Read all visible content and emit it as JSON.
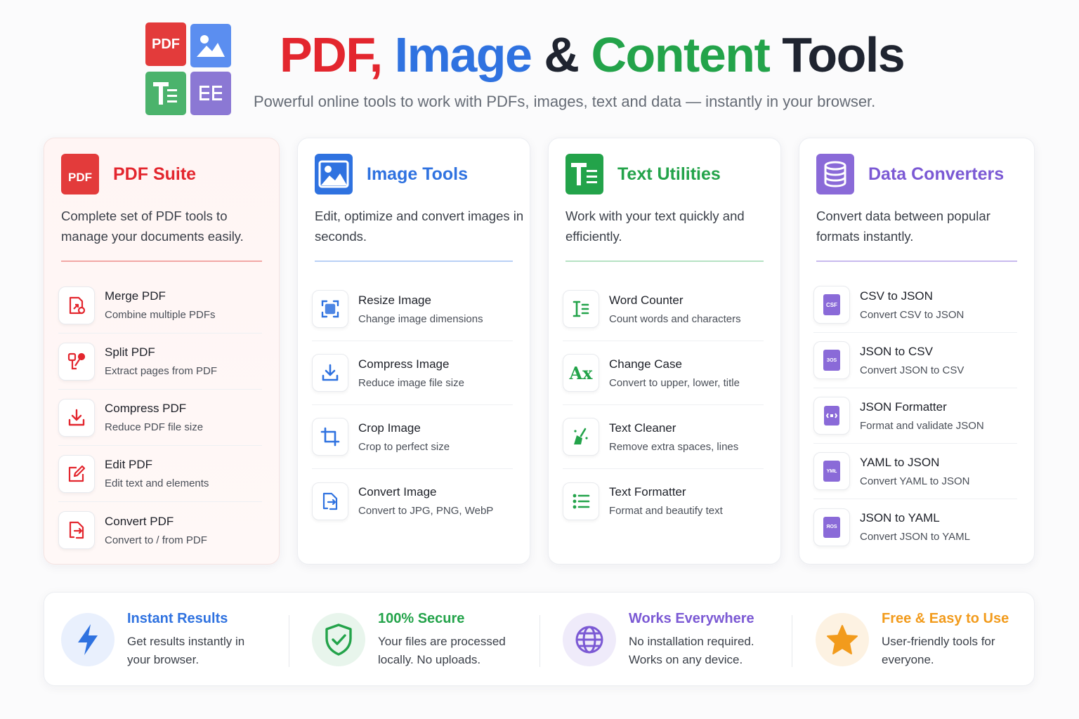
{
  "header": {
    "logo": {
      "pdf_tile_label": "PDF",
      "tiles": [
        "pdf-icon",
        "image-icon",
        "text-icon",
        "data-icon"
      ]
    },
    "title": {
      "part_pdf": "PDF,",
      "part_image": "Image",
      "part_amp": "&",
      "part_content": "Content",
      "part_tools": "Tools"
    },
    "subtitle": "Powerful online tools to work with PDFs, images, text and data — instantly in your browser."
  },
  "colors": {
    "pdf": "#e3262e",
    "image": "#2f72e0",
    "text": "#23a34a",
    "data": "#7b59d4",
    "orange": "#f29b1c"
  },
  "cards": {
    "pdf": {
      "icon": "pdf-file-icon",
      "icon_label": "PDF",
      "title": "PDF Suite",
      "description": "Complete set of PDF tools to manage your documents easily.",
      "tools": [
        {
          "name": "Merge PDF",
          "sub": "Combine multiple PDFs",
          "icon": "merge-icon"
        },
        {
          "name": "Split PDF",
          "sub": "Extract pages from PDF",
          "icon": "split-icon"
        },
        {
          "name": "Compress PDF",
          "sub": "Reduce PDF file size",
          "icon": "compress-icon"
        },
        {
          "name": "Edit PDF",
          "sub": "Edit text and elements",
          "icon": "edit-icon"
        },
        {
          "name": "Convert PDF",
          "sub": "Convert to / from PDF",
          "icon": "convert-icon"
        }
      ]
    },
    "image": {
      "icon": "image-icon",
      "title": "Image Tools",
      "description": "Edit, optimize and convert images in seconds.",
      "tools": [
        {
          "name": "Resize Image",
          "sub": "Change image dimensions",
          "icon": "resize-icon"
        },
        {
          "name": "Compress Image",
          "sub": "Reduce image file size",
          "icon": "download-icon"
        },
        {
          "name": "Crop Image",
          "sub": "Crop to perfect size",
          "icon": "crop-icon"
        },
        {
          "name": "Convert Image",
          "sub": "Convert to JPG, PNG, WebP",
          "icon": "convert-icon"
        }
      ]
    },
    "text": {
      "icon": "text-icon",
      "title": "Text Utilities",
      "description": "Work with your text quickly and efficiently.",
      "tools": [
        {
          "name": "Word Counter",
          "sub": "Count words and characters",
          "icon": "word-count-icon"
        },
        {
          "name": "Change Case",
          "sub": "Convert to upper, lower, title",
          "icon": "change-case-icon",
          "glyph": "Aх"
        },
        {
          "name": "Text Cleaner",
          "sub": "Remove extra spaces, lines",
          "icon": "broom-icon"
        },
        {
          "name": "Text Formatter",
          "sub": "Format and beautify text",
          "icon": "list-format-icon"
        }
      ]
    },
    "data": {
      "icon": "database-icon",
      "title": "Data Converters",
      "description": "Convert data between popular formats instantly.",
      "tools": [
        {
          "name": "CSV to JSON",
          "sub": "Convert CSV to JSON",
          "icon": "csv-file-icon",
          "file_label": "CSF"
        },
        {
          "name": "JSON to CSV",
          "sub": "Convert JSON to CSV",
          "icon": "json-file-icon",
          "file_label": "ЗОЅ"
        },
        {
          "name": "JSON Formatter",
          "sub": "Format and validate JSON",
          "icon": "json-format-icon",
          "file_label": ""
        },
        {
          "name": "YAML to JSON",
          "sub": "Convert YAML to JSON",
          "icon": "yaml-file-icon",
          "file_label": "YMŁ"
        },
        {
          "name": "JSON to YAML",
          "sub": "Convert JSON to YAML",
          "icon": "json-file-icon",
          "file_label": "ЯОЅ"
        }
      ]
    }
  },
  "features": [
    {
      "title": "Instant Results",
      "desc": "Get results instantly in your browser.",
      "icon": "lightning-icon"
    },
    {
      "title": "100% Secure",
      "desc": "Your files are processed locally. No uploads.",
      "icon": "shield-check-icon"
    },
    {
      "title": "Works Everywhere",
      "desc": "No installation required. Works on any device.",
      "icon": "globe-icon"
    },
    {
      "title": "Free & Easy to Use",
      "desc": "User-friendly tools for everyone.",
      "icon": "star-icon"
    }
  ]
}
